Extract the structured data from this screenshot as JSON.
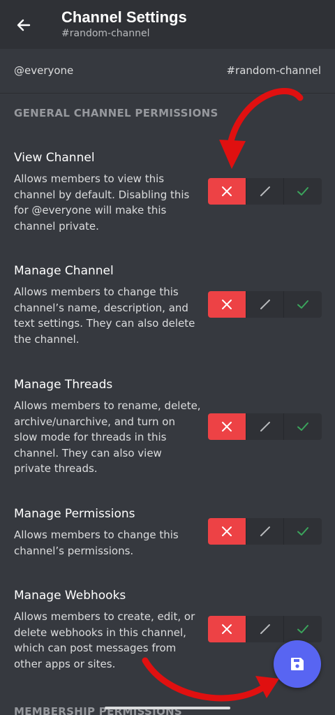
{
  "header": {
    "title": "Channel Settings",
    "subtitle": "#random-channel"
  },
  "role_bar": {
    "role": "@everyone",
    "channel": "#random-channel"
  },
  "section": {
    "title": "GENERAL CHANNEL PERMISSIONS"
  },
  "permissions": [
    {
      "title": "View Channel",
      "description": "Allows members to view this channel by default. Disabling this for @everyone will make this channel private.",
      "state": "deny"
    },
    {
      "title": "Manage Channel",
      "description": "Allows members to change this channel’s name, description, and text settings. They can also delete the channel.",
      "state": "deny"
    },
    {
      "title": "Manage Threads",
      "description": "Allows members to rename, delete, archive/unarchive, and turn on slow mode for threads in this channel. They can also view private threads.",
      "state": "deny"
    },
    {
      "title": "Manage Permissions",
      "description": "Allows members to change this channel’s permissions.",
      "state": "deny"
    },
    {
      "title": "Manage Webhooks",
      "description": "Allows members to create, edit, or delete webhooks in this channel, which can post messages from other apps or sites.",
      "state": "deny"
    }
  ],
  "next_section": {
    "title": "MEMBERSHIP PERMISSIONS"
  },
  "icons": {
    "back": "arrow-left-icon",
    "deny": "x-icon",
    "neutral": "slash-icon",
    "allow": "check-icon",
    "save": "floppy-disk-icon"
  },
  "colors": {
    "background": "#36393f",
    "header": "#2f3136",
    "deny_red": "#ed4245",
    "allow_green": "#3ba55c",
    "blurple": "#5865f2",
    "annotation_arrow": "#e01010"
  }
}
